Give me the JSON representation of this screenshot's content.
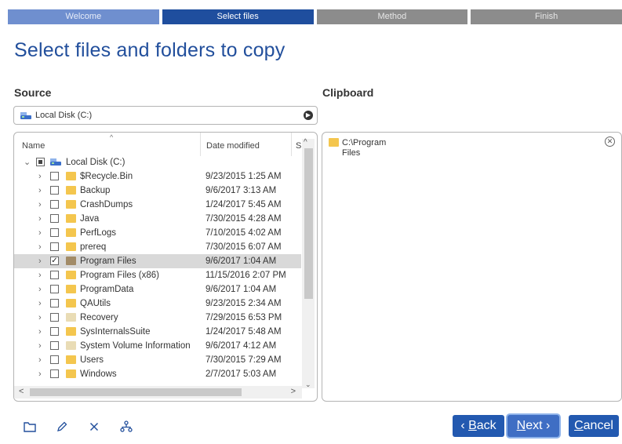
{
  "steps": [
    {
      "label": "Welcome",
      "state": "done"
    },
    {
      "label": "Select files",
      "state": "active"
    },
    {
      "label": "Method",
      "state": "todo"
    },
    {
      "label": "Finish",
      "state": "todo"
    }
  ],
  "title": "Select files and folders to copy",
  "source": {
    "label": "Source",
    "selected_drive": "Local Disk (C:)",
    "columns": {
      "name": "Name",
      "date": "Date modified",
      "size": "S"
    },
    "root": {
      "name": "Local Disk (C:)",
      "check": "partial"
    },
    "items": [
      {
        "name": "$Recycle.Bin",
        "date": "9/23/2015 1:25 AM",
        "checked": false,
        "selected": false,
        "folder_style": "normal"
      },
      {
        "name": "Backup",
        "date": "9/6/2017 3:13 AM",
        "checked": false,
        "selected": false,
        "folder_style": "normal"
      },
      {
        "name": "CrashDumps",
        "date": "1/24/2017 5:45 AM",
        "checked": false,
        "selected": false,
        "folder_style": "normal"
      },
      {
        "name": "Java",
        "date": "7/30/2015 4:28 AM",
        "checked": false,
        "selected": false,
        "folder_style": "normal"
      },
      {
        "name": "PerfLogs",
        "date": "7/10/2015 4:02 AM",
        "checked": false,
        "selected": false,
        "folder_style": "normal"
      },
      {
        "name": "prereq",
        "date": "7/30/2015 6:07 AM",
        "checked": false,
        "selected": false,
        "folder_style": "normal"
      },
      {
        "name": "Program Files",
        "date": "9/6/2017 1:04 AM",
        "checked": true,
        "selected": true,
        "folder_style": "selected"
      },
      {
        "name": "Program Files (x86)",
        "date": "11/15/2016 2:07 PM",
        "checked": false,
        "selected": false,
        "folder_style": "normal"
      },
      {
        "name": "ProgramData",
        "date": "9/6/2017 1:04 AM",
        "checked": false,
        "selected": false,
        "folder_style": "normal"
      },
      {
        "name": "QAUtils",
        "date": "9/23/2015 2:34 AM",
        "checked": false,
        "selected": false,
        "folder_style": "normal"
      },
      {
        "name": "Recovery",
        "date": "7/29/2015 6:53 PM",
        "checked": false,
        "selected": false,
        "folder_style": "gray"
      },
      {
        "name": "SysInternalsSuite",
        "date": "1/24/2017 5:48 AM",
        "checked": false,
        "selected": false,
        "folder_style": "normal"
      },
      {
        "name": "System Volume Information",
        "date": "9/6/2017 4:12 AM",
        "checked": false,
        "selected": false,
        "folder_style": "gray"
      },
      {
        "name": "Users",
        "date": "7/30/2015 7:29 AM",
        "checked": false,
        "selected": false,
        "folder_style": "normal"
      },
      {
        "name": "Windows",
        "date": "2/7/2017 5:03 AM",
        "checked": false,
        "selected": false,
        "folder_style": "normal"
      }
    ]
  },
  "clipboard": {
    "label": "Clipboard",
    "items": [
      {
        "path": "C:\\Program Files"
      }
    ]
  },
  "toolbar": {
    "icons": [
      "folder-icon",
      "pencil-icon",
      "close-icon",
      "network-icon"
    ]
  },
  "buttons": {
    "back_key": "B",
    "back_rest": "ack",
    "back_prefix": "‹ ",
    "next_key": "N",
    "next_rest": "ext",
    "next_suffix": " ›",
    "cancel_key": "C",
    "cancel_rest": "ancel"
  },
  "colors": {
    "accent": "#224f9c",
    "step_active": "#1f4e9e",
    "step_done": "#6f8fcf",
    "step_todo": "#8c8c8c",
    "button": "#2359b0"
  }
}
